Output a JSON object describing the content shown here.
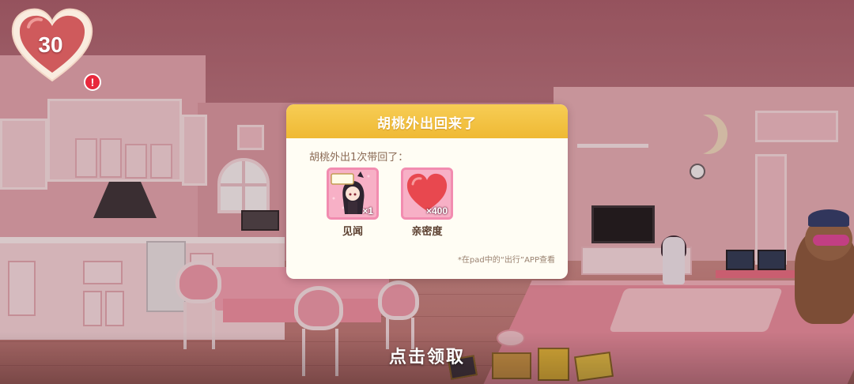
{
  "hud": {
    "affection_value": "30",
    "alert_mark": "!",
    "heart_icon": "heart-icon",
    "alert_icon": "exclamation-icon"
  },
  "dialog": {
    "title": "胡桃外出回来了",
    "subtitle": "胡桃外出1次带回了：",
    "rewards": [
      {
        "icon": "character-postcard-icon",
        "count": "×1",
        "label": "见闻"
      },
      {
        "icon": "heart-icon",
        "count": "×400",
        "label": "亲密度"
      }
    ],
    "note": "*在pad中的“出行”APP查看"
  },
  "claim_prompt": "点击领取",
  "colors": {
    "header_yellow": "#f2c040",
    "dialog_bg": "#fffdf4",
    "reward_pink": "#f7b0c6",
    "heart_red": "#e8484f"
  }
}
